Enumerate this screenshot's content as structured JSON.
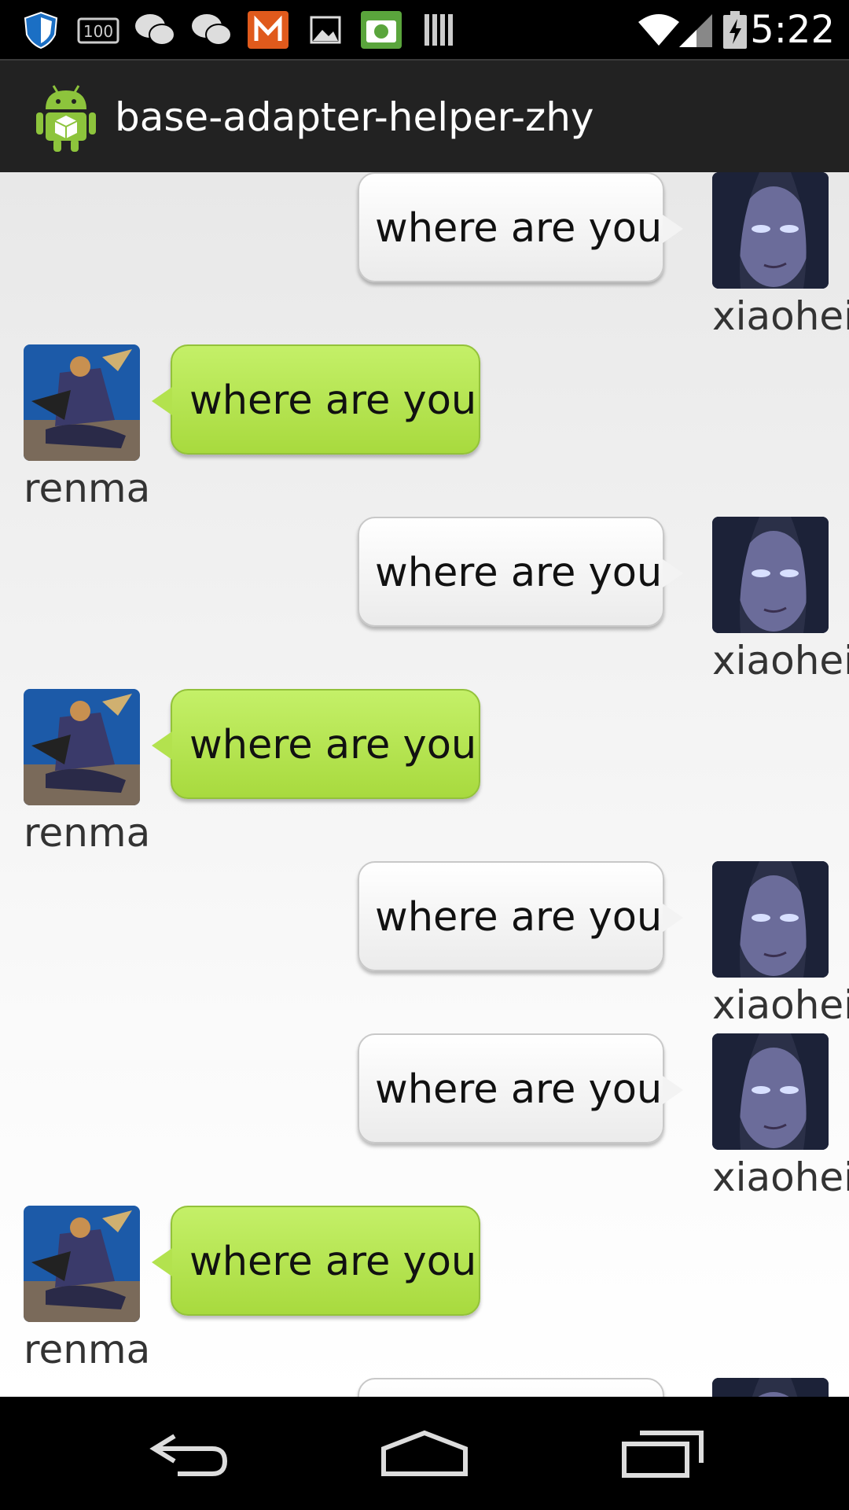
{
  "status_bar": {
    "time": "5:22",
    "left_icons": [
      "shield-icon",
      "battery-100-icon",
      "wechat-icon",
      "wechat-icon",
      "app-m-icon",
      "image-icon",
      "camera-icon",
      "barcode-icon"
    ],
    "right_icons": [
      "wifi-icon",
      "signal-icon",
      "battery-charging-icon"
    ]
  },
  "action_bar": {
    "title": "base-adapter-helper-zhy",
    "icon": "android-icon"
  },
  "chat": {
    "messages": [
      {
        "side": "right",
        "text": "where are you",
        "name": "xiaohei"
      },
      {
        "side": "left",
        "text": "where are you",
        "name": "renma"
      },
      {
        "side": "right",
        "text": "where are you",
        "name": "xiaohei"
      },
      {
        "side": "left",
        "text": "where are you",
        "name": "renma"
      },
      {
        "side": "right",
        "text": "where are you",
        "name": "xiaohei"
      },
      {
        "side": "right",
        "text": "where are you",
        "name": "xiaohei"
      },
      {
        "side": "left",
        "text": "where are you",
        "name": "renma"
      },
      {
        "side": "right",
        "text": "",
        "name": ""
      }
    ]
  },
  "nav_bar": {
    "buttons": [
      "back-icon",
      "home-icon",
      "recents-icon"
    ]
  },
  "colors": {
    "sent_bubble": "#b4e452",
    "received_bubble": "#f4f4f4",
    "action_bar": "#222222"
  }
}
